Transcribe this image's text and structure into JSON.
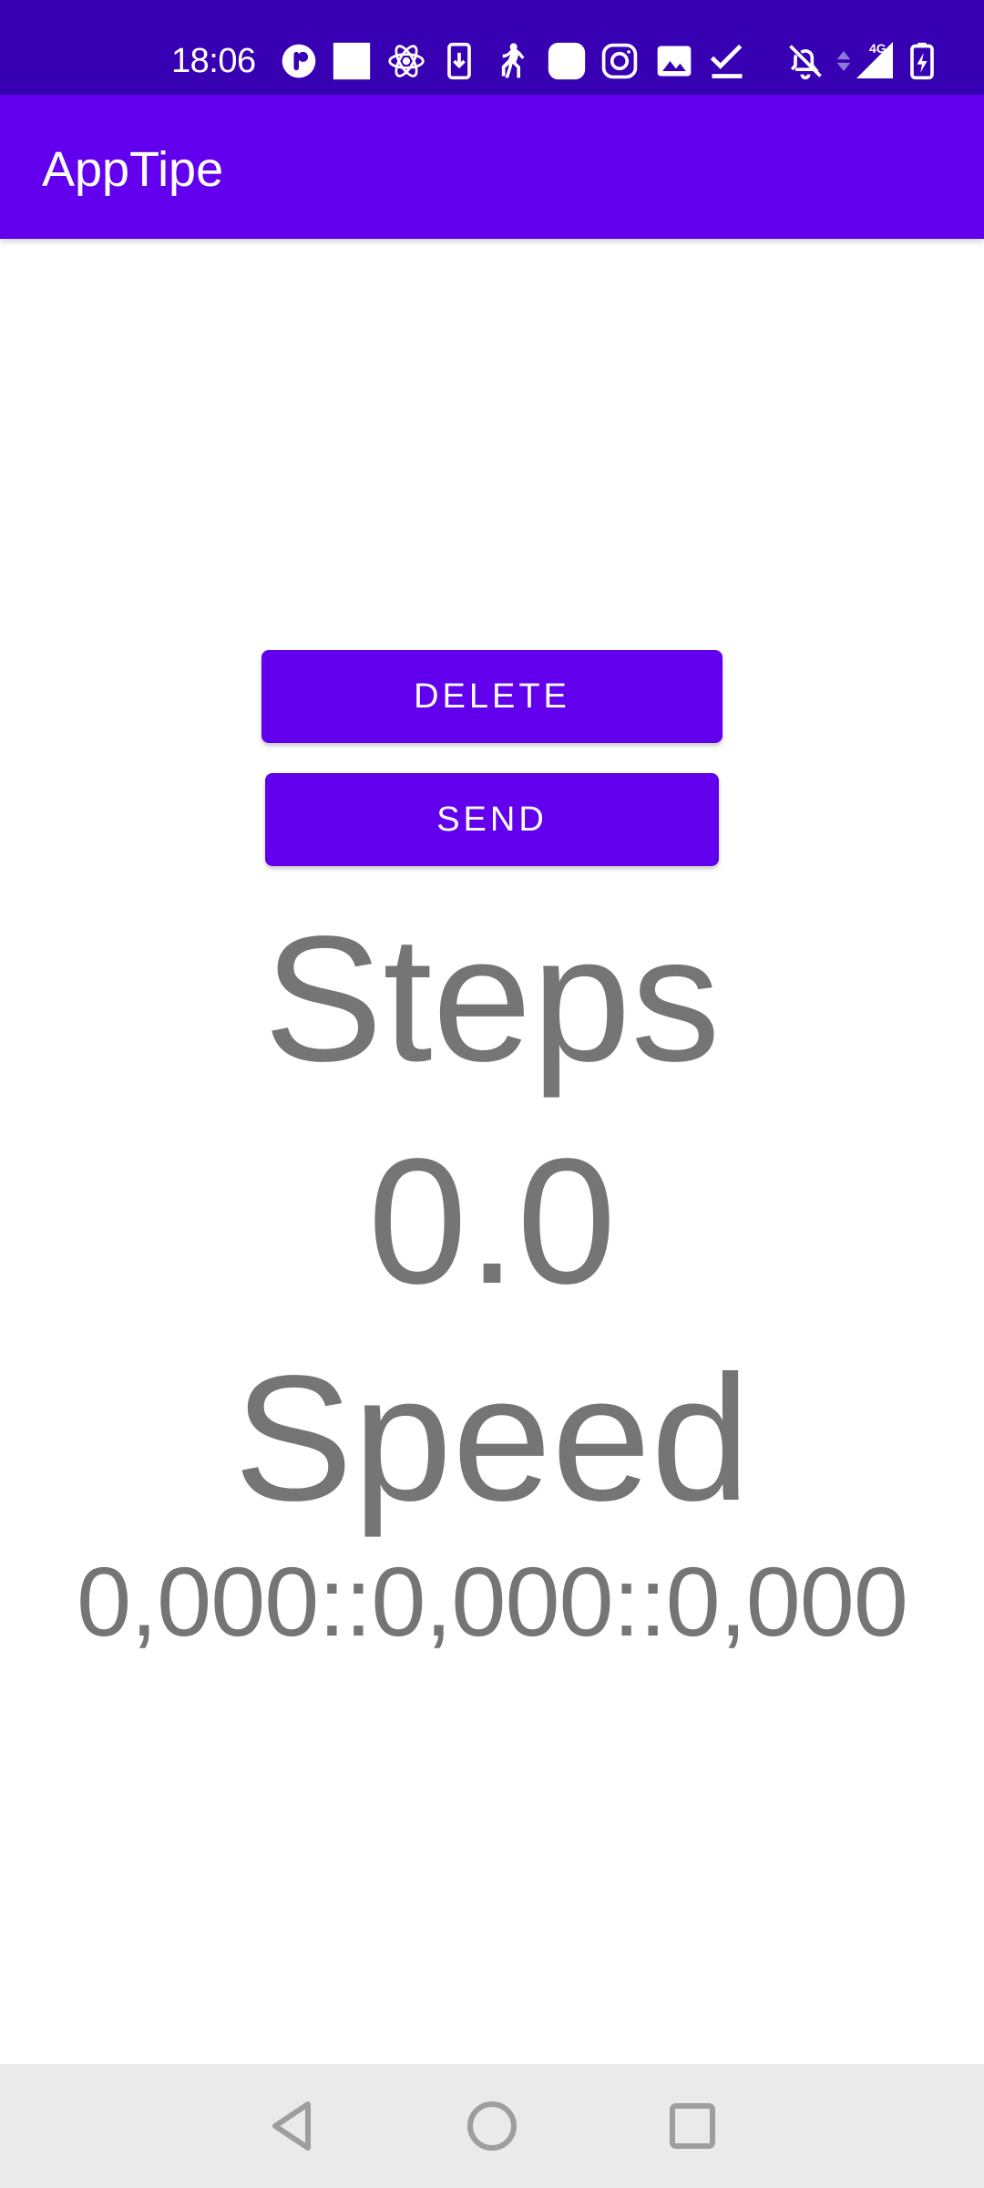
{
  "status_bar": {
    "time": "18:06",
    "network_label": "4G",
    "icons": [
      "app-circle-icon",
      "square-app-icon",
      "atom-icon",
      "download-icon",
      "running-person-icon",
      "rounded-square-icon",
      "instagram-icon",
      "image-icon",
      "checkmark-icon",
      "bell-off-icon",
      "signal-icon",
      "battery-charging-icon"
    ],
    "colors": {
      "background": "#3700B3",
      "foreground": "#FFFFFF"
    }
  },
  "app_bar": {
    "title": "AppTipe",
    "color": "#6200EE"
  },
  "buttons": {
    "delete_label": "DELETE",
    "send_label": "SEND"
  },
  "content": {
    "steps_label": "Steps",
    "steps_value": "0.0",
    "speed_label": "Speed",
    "speed_value": "0,000::0,000::0,000",
    "text_color": "#757575"
  },
  "nav_bar": {
    "icons": [
      "back-icon",
      "home-icon",
      "recent-apps-icon"
    ],
    "background": "#EAEAEA"
  }
}
